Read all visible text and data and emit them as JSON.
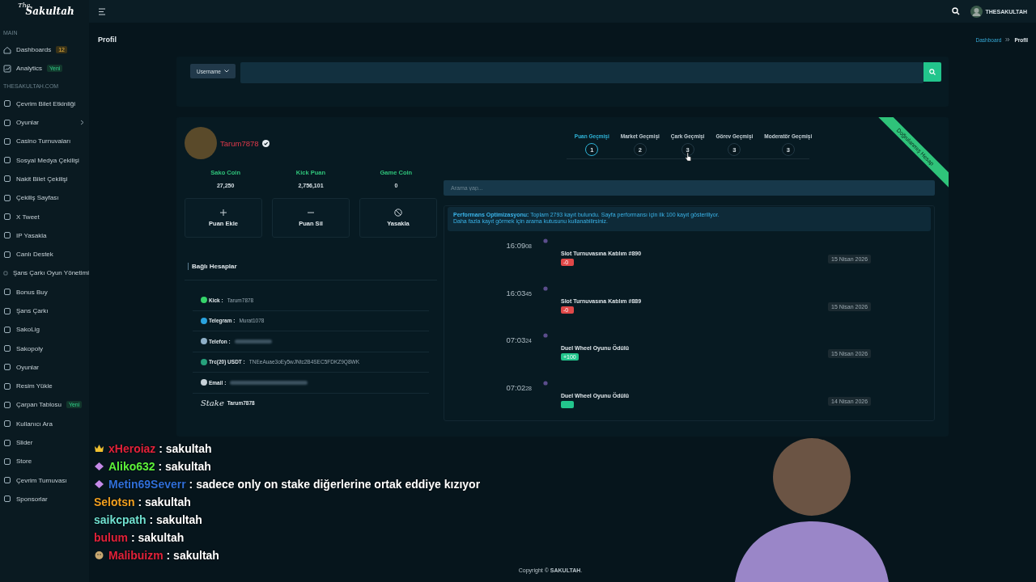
{
  "brand": {
    "small": "The",
    "name": "Sakultah"
  },
  "topbar": {
    "user": "THESAKULTAH"
  },
  "sidebar": {
    "sections": [
      {
        "heading": "MAIN",
        "items": [
          {
            "label": "Dashboards",
            "badge": {
              "text": "12",
              "kind": "warning"
            }
          },
          {
            "label": "Analytics",
            "badge": {
              "text": "Yeni",
              "kind": "success"
            }
          }
        ]
      },
      {
        "heading": "THESAKULTAH.COM",
        "items": [
          {
            "label": "Çevrim Bilet Etkinliği"
          },
          {
            "label": "Oyunlar",
            "submenu": true
          },
          {
            "label": "Casino Turnuvaları"
          },
          {
            "label": "Sosyal Medya Çekilişi"
          },
          {
            "label": "Nakit Bilet Çekilişi"
          },
          {
            "label": "Çekiliş Sayfası"
          },
          {
            "label": "X Tweet"
          },
          {
            "label": "IP Yasakla"
          },
          {
            "label": "Canlı Destek"
          },
          {
            "label": "Şans Çarkı Oyun Yönetimi"
          },
          {
            "label": "Bonus Buy"
          },
          {
            "label": "Şans Çarkı"
          },
          {
            "label": "SakoLig"
          },
          {
            "label": "Sakopoly"
          },
          {
            "label": "Oyunlar"
          },
          {
            "label": "Resim Yükle"
          },
          {
            "label": "Çarpan Tablosu",
            "badge": {
              "text": "Yeni",
              "kind": "success"
            }
          },
          {
            "label": "Kullanıcı Ara"
          },
          {
            "label": "Slider"
          },
          {
            "label": "Store"
          },
          {
            "label": "Çevrim Turnuvası"
          },
          {
            "label": "Sponsorlar"
          }
        ]
      }
    ]
  },
  "page": {
    "title": "Profil",
    "breadcrumb": [
      "Dashboard",
      "Profil"
    ]
  },
  "search": {
    "filter": "Username"
  },
  "profile": {
    "username": "Tarum7878",
    "verified": true,
    "ribbon": "Doğrulanmış Hesap",
    "stats": [
      {
        "label": "Sako Coin",
        "value": "27,250"
      },
      {
        "label": "Kick Puan",
        "value": "2,756,101"
      },
      {
        "label": "Game Coin",
        "value": "0"
      }
    ],
    "actions": [
      {
        "kind": "add",
        "label": "Puan Ekle"
      },
      {
        "kind": "remove",
        "label": "Puan Sil"
      },
      {
        "kind": "ban",
        "label": "Yasakla"
      }
    ],
    "accounts_title": "Bağlı Hesaplar",
    "accounts": [
      {
        "kind": "kick",
        "label": "Kick :",
        "value": "Tarum7878",
        "color": "#35d46a"
      },
      {
        "kind": "telegram",
        "label": "Telegram :",
        "value": "Murat1078",
        "color": "#2aa3df"
      },
      {
        "kind": "phone",
        "label": "Telefon :",
        "blurred": true,
        "color": "#8fb0c8"
      },
      {
        "kind": "usdt",
        "label": "Trc(20) USDT :",
        "value": "TNEeAuae3oEy5wJNtc2B4SEC5FDKZ9Q8WK",
        "color": "#26a17b"
      },
      {
        "kind": "email",
        "label": "Email :",
        "blurred": true,
        "color": "#c8d3da"
      },
      {
        "kind": "stake",
        "label": "Stake",
        "value": "Tarum7878"
      }
    ]
  },
  "history": {
    "steps": [
      {
        "label": "Puan Geçmişi",
        "number": "1",
        "selected": true
      },
      {
        "label": "Market Geçmişi",
        "number": "2",
        "selected": false
      },
      {
        "label": "Çark Geçmişi",
        "number": "3",
        "selected": false
      },
      {
        "label": "Görev Geçmişi",
        "number": "3",
        "selected": false
      },
      {
        "label": "Moderatör Geçmişi",
        "number": "3",
        "selected": false
      }
    ],
    "search_placeholder": "Arama yap...",
    "notice": {
      "text": "**Performans Optimizasyonu:** Toplam 2793 kayıt bulundu. Sayfa performansı için ilk 100 kayıt gösteriliyor.",
      "hint": "Daha fazla kayıt görmek için arama kutusunu kullanabilirsiniz."
    },
    "entries": [
      {
        "time": "16:09",
        "seconds": "08",
        "title": "Slot Turnuvasına Katılım #890",
        "kind": "negative",
        "amount": "-0",
        "date": "15 Nisan 2026"
      },
      {
        "time": "16:03",
        "seconds": "45",
        "title": "Slot Turnuvasına Katılım #889",
        "kind": "negative",
        "amount": "-0",
        "date": "15 Nisan 2026"
      },
      {
        "time": "07:03",
        "seconds": "24",
        "title": "Duel Wheel Oyunu Ödülü",
        "kind": "positive",
        "amount": "+100",
        "date": "15 Nisan 2026"
      },
      {
        "time": "07:02",
        "seconds": "28",
        "title": "Duel Wheel Oyunu Ödülü",
        "kind": "positive",
        "date": "14 Nisan 2026"
      }
    ]
  },
  "chat": [
    {
      "user": "xHeroiaz",
      "color": "#e0223a",
      "badge": {
        "kind": "crown"
      },
      "text": ": sakultah"
    },
    {
      "user": "Aliko632",
      "color": "#5cf03a",
      "badge": {
        "kind": "gem"
      },
      "text": ": sakultah"
    },
    {
      "user": "Metin69Severr",
      "color": "#2f6fd8",
      "badge": {
        "kind": "gem"
      },
      "text": ": sadece only on stake diğerlerine ortak eddiye kızıyor"
    },
    {
      "user": "Selotsn",
      "color": "#f0a020",
      "text": ": sakultah"
    },
    {
      "user": "saikcpath",
      "color": "#6fe0d0",
      "text": ": sakultah"
    },
    {
      "user": "bulum",
      "color": "#e0223a",
      "text": ": sakultah"
    },
    {
      "user": "Malibuizm",
      "color": "#e0223a",
      "badge": {
        "kind": "face"
      },
      "text": ": sakultah"
    }
  ],
  "footer": {
    "text": "Copyright © **SAKULTAH**."
  }
}
